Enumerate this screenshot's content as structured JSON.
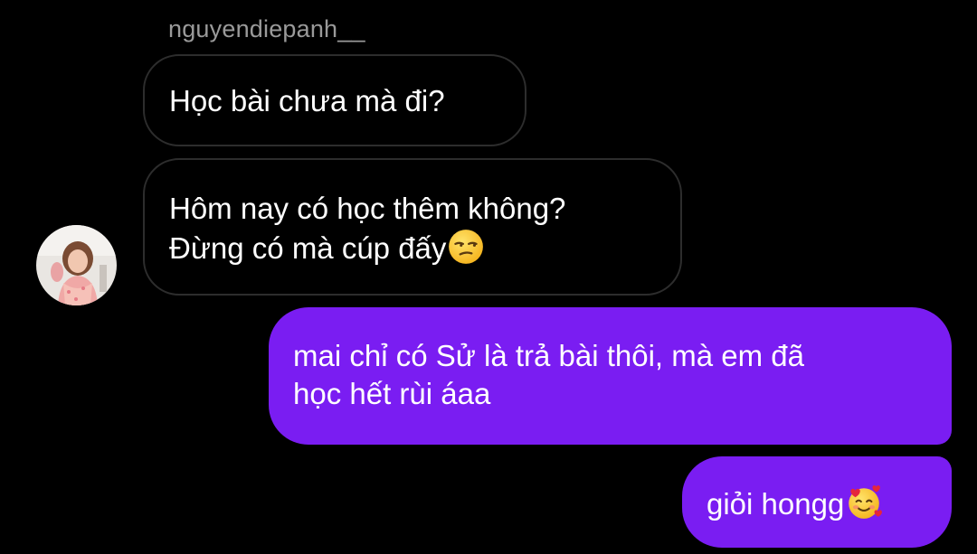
{
  "thread": {
    "sender_username": "nguyendiepanh__",
    "avatar_alt": "avatar"
  },
  "messages": [
    {
      "direction": "incoming",
      "lines": [
        "Học bài chưa mà đi?"
      ]
    },
    {
      "direction": "incoming",
      "lines": [
        "Hôm nay có học thêm không?",
        "Đừng có mà cúp đấy"
      ],
      "emoji_icon": "unamused-face-icon"
    },
    {
      "direction": "outgoing",
      "lines": [
        "mai chỉ có Sử là trả bài thôi, mà em đã",
        "học hết rùi áaa"
      ]
    },
    {
      "direction": "outgoing",
      "lines": [
        "giỏi hongg"
      ],
      "emoji_icon": "smiling-face-with-hearts-icon"
    }
  ],
  "colors": {
    "background": "#000000",
    "outgoing_bubble": "#7a1df2",
    "incoming_border": "#2d2d2d",
    "username": "#9a9a9a",
    "text": "#ffffff"
  }
}
